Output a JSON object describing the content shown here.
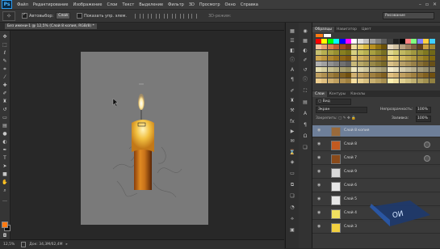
{
  "menubar": {
    "logo": "Ps",
    "items": [
      "Файл",
      "Редактирование",
      "Изображение",
      "Слои",
      "Текст",
      "Выделение",
      "Фильтр",
      "3D",
      "Просмотр",
      "Окно",
      "Справка"
    ]
  },
  "options": {
    "auto_select_label": "Автовыбор:",
    "auto_select_value": "Слой",
    "show_controls_label": "Показать упр. элем.",
    "mode3d_label": "3D-режим:",
    "workspace": "Рисование"
  },
  "document": {
    "tab_title": "Без имени-1 @ 12,5% (Слой 8 копия, RGB/8) *",
    "zoom": "12,5%",
    "doc_info": "Док: 34,3M/62,4M"
  },
  "panels": {
    "top_tabs": [
      "Образцы",
      "Навигатор",
      "Цвет"
    ],
    "layer_tabs": [
      "Слои",
      "Контуры",
      "Каналы"
    ],
    "blend_mode": "Экран",
    "opacity_label": "Непрозрачность:",
    "opacity_value": "100%",
    "fill_label": "Заливка:",
    "fill_value": "100%"
  },
  "layers": [
    {
      "name": "Слой 8 копия",
      "selected": true,
      "thumb_color": "#9a6a3a",
      "fx": false
    },
    {
      "name": "Слой 8",
      "selected": false,
      "thumb_color": "#c25a20",
      "fx": true
    },
    {
      "name": "Слой 7",
      "selected": false,
      "thumb_color": "#8a4a1a",
      "fx": true
    },
    {
      "name": "Слой 9",
      "selected": false,
      "thumb_color": "#d8d8d8",
      "fx": false
    },
    {
      "name": "Слой 6",
      "selected": false,
      "thumb_color": "#e6e6e6",
      "fx": false
    },
    {
      "name": "Слой 5",
      "selected": false,
      "thumb_color": "#e6e6e6",
      "fx": false
    },
    {
      "name": "Слой 4",
      "selected": false,
      "thumb_color": "#f0e060",
      "fx": false
    },
    {
      "name": "Слой 3",
      "selected": false,
      "thumb_color": "#f2d040",
      "fx": false
    }
  ],
  "colors": {
    "foreground": "#ff7a12",
    "background": "#0f0f0f",
    "selected_layer": "#6e7f99"
  }
}
